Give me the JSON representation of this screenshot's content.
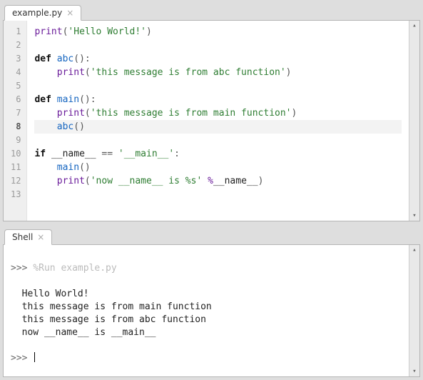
{
  "editor": {
    "tab_label": "example.py",
    "current_line": 8,
    "lines": [
      {
        "n": 1,
        "tokens": [
          [
            "builtin",
            "print"
          ],
          [
            "p",
            "("
          ],
          [
            "str",
            "'Hello World!'"
          ],
          [
            "p",
            ")"
          ]
        ]
      },
      {
        "n": 2,
        "tokens": []
      },
      {
        "n": 3,
        "tokens": [
          [
            "kw",
            "def"
          ],
          [
            "txt",
            " "
          ],
          [
            "fn",
            "abc"
          ],
          [
            "p",
            "():"
          ]
        ]
      },
      {
        "n": 4,
        "tokens": [
          [
            "txt",
            "    "
          ],
          [
            "builtin",
            "print"
          ],
          [
            "p",
            "("
          ],
          [
            "str",
            "'this message is from abc function'"
          ],
          [
            "p",
            ")"
          ]
        ]
      },
      {
        "n": 5,
        "tokens": []
      },
      {
        "n": 6,
        "tokens": [
          [
            "kw",
            "def"
          ],
          [
            "txt",
            " "
          ],
          [
            "fn",
            "main"
          ],
          [
            "p",
            "():"
          ]
        ]
      },
      {
        "n": 7,
        "tokens": [
          [
            "txt",
            "    "
          ],
          [
            "builtin",
            "print"
          ],
          [
            "p",
            "("
          ],
          [
            "str",
            "'this message is from main function'"
          ],
          [
            "p",
            ")"
          ]
        ]
      },
      {
        "n": 8,
        "tokens": [
          [
            "txt",
            "    "
          ],
          [
            "fn",
            "abc"
          ],
          [
            "p",
            "()"
          ]
        ]
      },
      {
        "n": 9,
        "tokens": []
      },
      {
        "n": 10,
        "tokens": [
          [
            "kw",
            "if"
          ],
          [
            "txt",
            " "
          ],
          [
            "dunder",
            "__name__"
          ],
          [
            "txt",
            " "
          ],
          [
            "p",
            "=="
          ],
          [
            "txt",
            " "
          ],
          [
            "str",
            "'__main__'"
          ],
          [
            "p",
            ":"
          ]
        ]
      },
      {
        "n": 11,
        "tokens": [
          [
            "txt",
            "    "
          ],
          [
            "fn",
            "main"
          ],
          [
            "p",
            "()"
          ]
        ]
      },
      {
        "n": 12,
        "tokens": [
          [
            "txt",
            "    "
          ],
          [
            "builtin",
            "print"
          ],
          [
            "p",
            "("
          ],
          [
            "str",
            "'now __name__ is %s'"
          ],
          [
            "txt",
            " "
          ],
          [
            "op",
            "%"
          ],
          [
            "dunder",
            "__name__"
          ],
          [
            "p",
            ")"
          ]
        ]
      },
      {
        "n": 13,
        "tokens": []
      }
    ]
  },
  "shell": {
    "tab_label": "Shell",
    "prompt": ">>>",
    "run_cmd": "%Run example.py",
    "output": [
      "Hello World!",
      "this message is from main function",
      "this message is from abc function",
      "now __name__ is __main__"
    ]
  }
}
